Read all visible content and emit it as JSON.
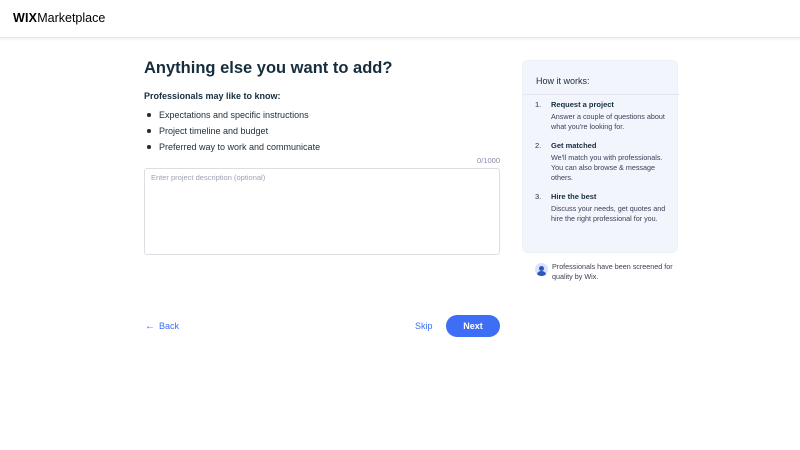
{
  "header": {
    "logo_brand": "WIX",
    "logo_product": "Marketplace"
  },
  "main": {
    "title": "Anything else you want to add?",
    "subtitle": "Professionals may like to know:",
    "tips": [
      "Expectations and specific instructions",
      "Project timeline and budget",
      "Preferred way to work and communicate"
    ],
    "char_counter": "0/1000",
    "description": {
      "value": "",
      "placeholder": "Enter project description (optional)"
    }
  },
  "footer_nav": {
    "back_label": "Back",
    "skip_label": "Skip",
    "next_label": "Next"
  },
  "how_it_works": {
    "title": "How it works:",
    "steps": [
      {
        "num": "1.",
        "heading": "Request a project",
        "text": "Answer a couple of questions about what you're looking for."
      },
      {
        "num": "2.",
        "heading": "Get matched",
        "text": "We'll match you with professionals. You can also browse & message others."
      },
      {
        "num": "3.",
        "heading": "Hire the best",
        "text": "Discuss your needs, get quotes and hire the right professional for you."
      }
    ]
  },
  "screened_note": "Professionals have been screened for quality by Wix.",
  "colors": {
    "accent": "#3d6ef5",
    "card_bg": "#f3f5fd",
    "heading": "#162d3d"
  }
}
